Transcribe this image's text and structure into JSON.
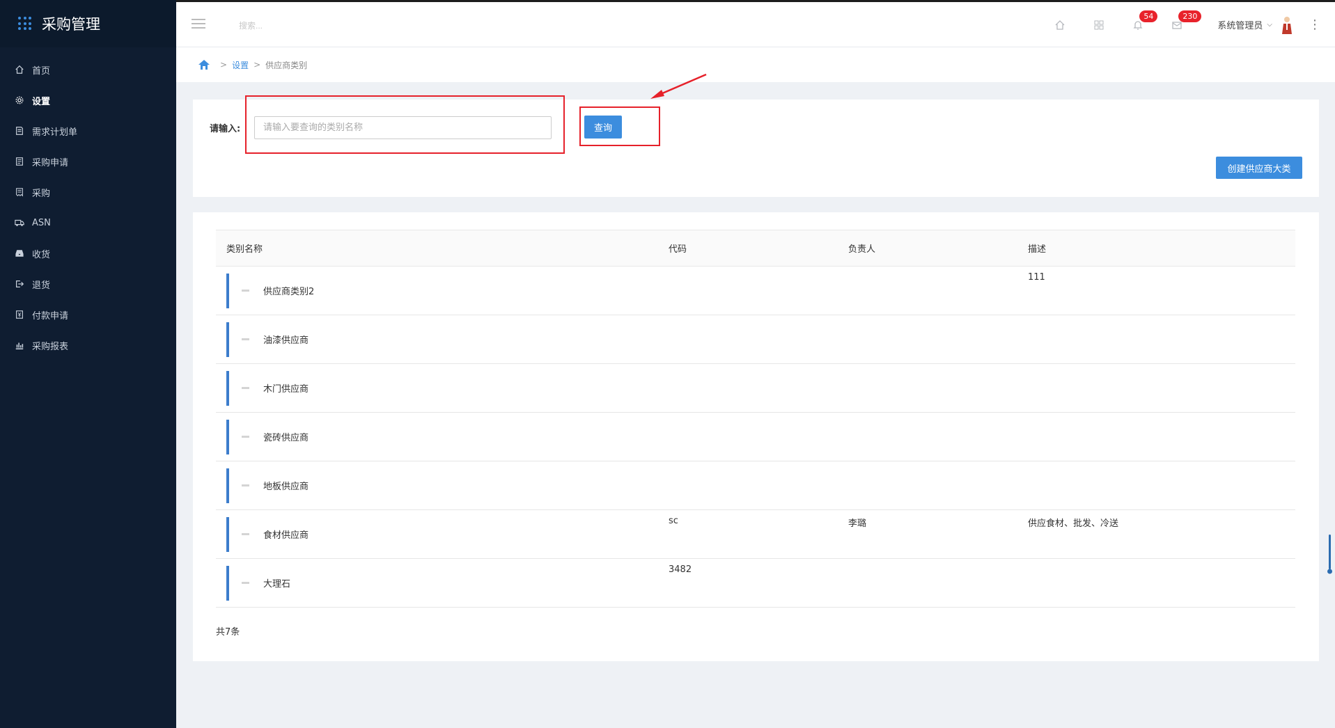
{
  "app": {
    "title": "采购管理"
  },
  "sidebar": {
    "items": [
      {
        "label": "首页",
        "icon": "home-icon"
      },
      {
        "label": "设置",
        "icon": "gear-icon",
        "active": true
      },
      {
        "label": "需求计划单",
        "icon": "document-icon"
      },
      {
        "label": "采购申请",
        "icon": "clipboard-icon"
      },
      {
        "label": "采购",
        "icon": "receipt-icon"
      },
      {
        "label": "ASN",
        "icon": "truck-icon"
      },
      {
        "label": "收货",
        "icon": "inbox-icon"
      },
      {
        "label": "退货",
        "icon": "return-icon"
      },
      {
        "label": "付款申请",
        "icon": "payment-icon"
      },
      {
        "label": "采购报表",
        "icon": "bar-chart-icon"
      }
    ]
  },
  "header": {
    "search_placeholder": "搜索...",
    "notifications_count": "54",
    "messages_count": "230",
    "user_name": "系统管理员"
  },
  "breadcrumb": {
    "items": [
      "设置",
      "供应商类别"
    ]
  },
  "search_form": {
    "label": "请输入:",
    "placeholder": "请输入要查询的类别名称",
    "query_button": "查询",
    "create_button": "创建供应商大类"
  },
  "table": {
    "columns": [
      "类别名称",
      "代码",
      "负责人",
      "描述"
    ],
    "rows": [
      {
        "name": "供应商类别2",
        "code": "",
        "owner": "",
        "desc": "111"
      },
      {
        "name": "油漆供应商",
        "code": "",
        "owner": "",
        "desc": ""
      },
      {
        "name": "木门供应商",
        "code": "",
        "owner": "",
        "desc": ""
      },
      {
        "name": "瓷砖供应商",
        "code": "",
        "owner": "",
        "desc": ""
      },
      {
        "name": "地板供应商",
        "code": "",
        "owner": "",
        "desc": ""
      },
      {
        "name": "食材供应商",
        "code": "sc",
        "owner": "李璐",
        "desc": "供应食材、批发、冷送"
      },
      {
        "name": "大理石",
        "code": "3482",
        "owner": "",
        "desc": ""
      }
    ],
    "total_text": "共7条"
  },
  "colors": {
    "sidebar_bg": "#0f1d31",
    "accent": "#3c8dde",
    "badge": "#e8222b",
    "annotation": "#e6212a"
  }
}
